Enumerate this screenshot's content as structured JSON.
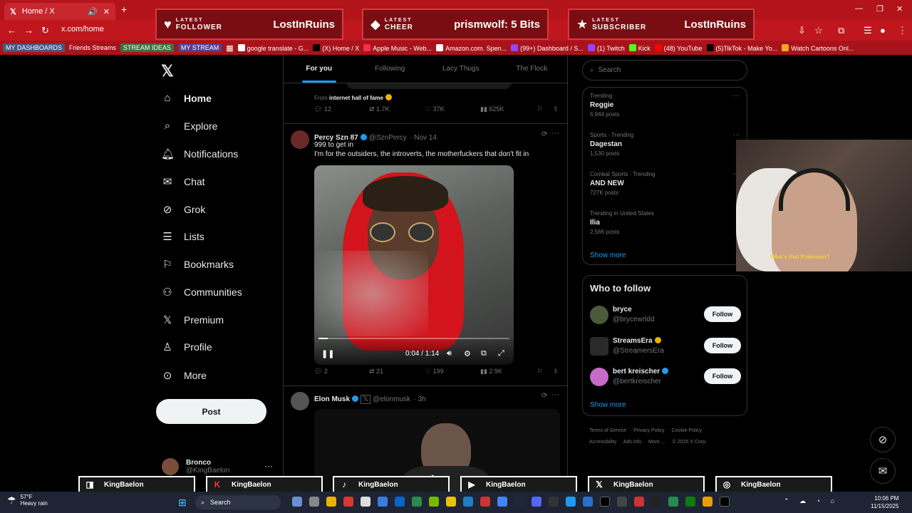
{
  "browser": {
    "tab_title": "Home / X",
    "url": "x.com/home",
    "bookmarks": [
      "MY DASHBOARDS",
      "Friends Streams",
      "STREAM IDEAS",
      "MY STREAM",
      "google translate - G...",
      "(X) Home / X",
      "Apple Music - Web...",
      "Amazon.com. Spen...",
      "(99+) Dashboard / S...",
      "(1) Twitch",
      "Kick",
      "(48) YouTube",
      "(5)TikTok - Make Yo...",
      "Watch Cartoons Onl..."
    ]
  },
  "alerts": [
    {
      "caption": "LATEST",
      "kind": "FOLLOWER",
      "value": "LostInRuins"
    },
    {
      "caption": "LATEST",
      "kind": "CHEER",
      "value": "prismwolf: 5 Bits"
    },
    {
      "caption": "LATEST",
      "kind": "SUBSCRIBER",
      "value": "LostInRuins"
    }
  ],
  "sidebar": {
    "items": [
      {
        "label": "Home",
        "icon": "home-icon"
      },
      {
        "label": "Explore",
        "icon": "search-icon"
      },
      {
        "label": "Notifications",
        "icon": "bell-icon"
      },
      {
        "label": "Chat",
        "icon": "mail-icon"
      },
      {
        "label": "Grok",
        "icon": "grok-icon"
      },
      {
        "label": "Lists",
        "icon": "list-icon"
      },
      {
        "label": "Bookmarks",
        "icon": "bookmark-icon"
      },
      {
        "label": "Communities",
        "icon": "people-icon"
      },
      {
        "label": "Premium",
        "icon": "x-icon"
      },
      {
        "label": "Profile",
        "icon": "user-icon"
      },
      {
        "label": "More",
        "icon": "more-icon"
      }
    ],
    "post_label": "Post",
    "account": {
      "name": "Bronco",
      "handle": "@KingBaelon"
    }
  },
  "timeline": {
    "tabs": [
      "For you",
      "Following",
      "Lacy Thugs",
      "The Flock"
    ],
    "prev_tweet": {
      "from_prefix": "From",
      "from_source": "internet hall of fame",
      "replies": "12",
      "retweets": "1.7K",
      "likes": "37K",
      "views": "625K"
    },
    "tweet1": {
      "name": "Percy Szn 87",
      "handle": "@SznPercy",
      "date": "Nov 14",
      "line1": "999 to get in",
      "line2": "I'm for the outsiders, the introverts, the motherfuckers that don't fit in",
      "video_time": "0:04 / 1:14",
      "progress": 0.05,
      "replies": "2",
      "retweets": "21",
      "likes": "199",
      "views": "2.9K"
    },
    "tweet2": {
      "name": "Elon Musk",
      "handle": "@elonmusk",
      "date": "3h"
    }
  },
  "right": {
    "search_placeholder": "Search",
    "trends": [
      {
        "context": "Trending",
        "title": "Reggie",
        "posts": "6,944 posts"
      },
      {
        "context": "Sports · Trending",
        "title": "Dagestan",
        "posts": "1,530 posts"
      },
      {
        "context": "Combat Sports · Trending",
        "title": "AND NEW",
        "posts": "727K posts"
      },
      {
        "context": "Trending in United States",
        "title": "Ilia",
        "posts": "2,566 posts"
      }
    ],
    "show_more": "Show more",
    "wtf_title": "Who to follow",
    "follow_label": "Follow",
    "who_to_follow": [
      {
        "name": "bryce",
        "handle": "@brycewrldd"
      },
      {
        "name": "StreamsEra",
        "handle": "@StreamersEra"
      },
      {
        "name": "bert kreischer",
        "handle": "@bertkreischer"
      }
    ],
    "footer": [
      "Terms of Service",
      "Privacy Policy",
      "Cookie Policy",
      "Accessibility",
      "Ads info",
      "More ...",
      "© 2025 X Corp."
    ]
  },
  "webcam_caption": "Who's that Pokémon?",
  "stream_bars": [
    {
      "platform": "twitch",
      "name": "KingBaelon"
    },
    {
      "platform": "kick",
      "name": "KingBaelon"
    },
    {
      "platform": "tiktok",
      "name": "KingBaelon"
    },
    {
      "platform": "youtube",
      "name": "KingBaelon"
    },
    {
      "platform": "x",
      "name": "KingBaelon"
    },
    {
      "platform": "instagram",
      "name": "KingBaelon"
    }
  ],
  "taskbar": {
    "temp": "57°F",
    "weather": "Heavy rain",
    "search": "Search",
    "time": "10:06 PM",
    "date": "11/15/2025"
  }
}
